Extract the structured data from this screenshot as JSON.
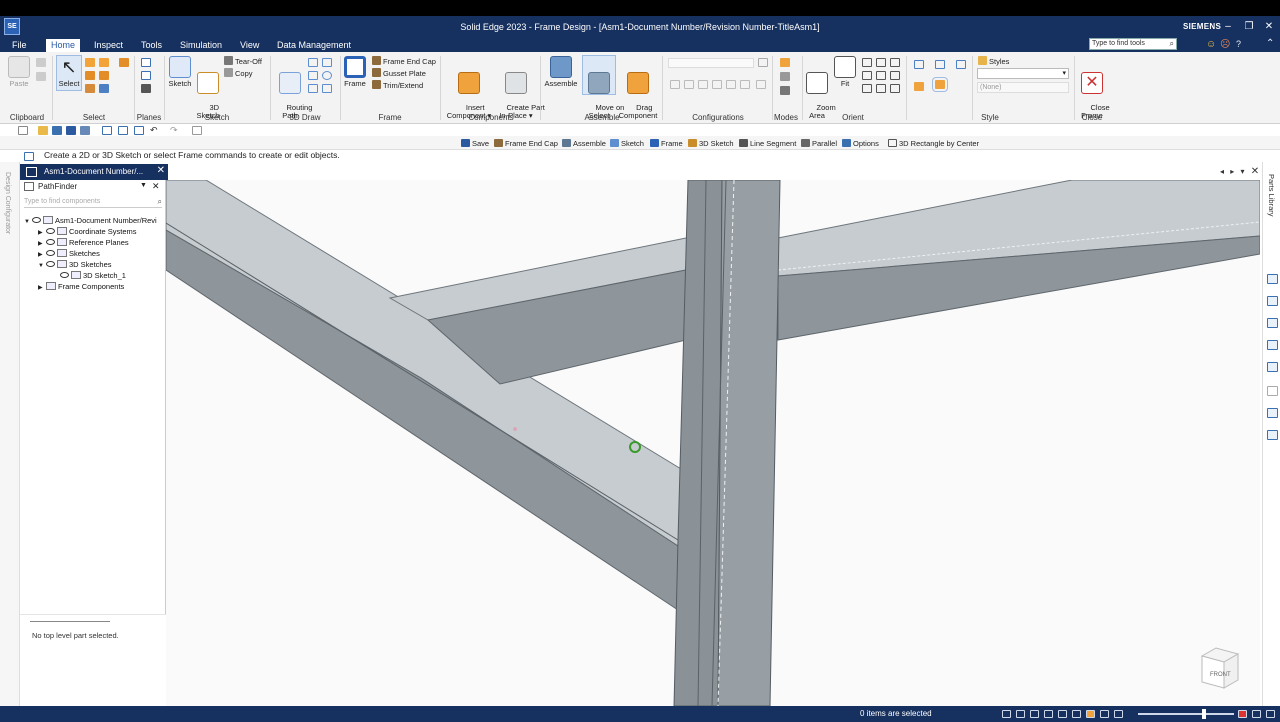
{
  "titlebar": {
    "app_logo": "SE",
    "title": "Solid Edge 2023 - Frame Design - [Asm1-Document Number/Revision Number-TitleAsm1]",
    "brand": "SIEMENS",
    "buttons": [
      "–",
      "❐",
      "✕"
    ]
  },
  "menubar": {
    "items": [
      "File",
      "Home",
      "Inspect",
      "Tools",
      "Simulation",
      "View",
      "Data Management"
    ],
    "active": "Home",
    "search_placeholder": "Type to find tools"
  },
  "ribbon": {
    "clipboard": {
      "paste": "Paste",
      "group": "Clipboard"
    },
    "select": {
      "select": "Select",
      "group": "Select"
    },
    "planes": {
      "group": "Planes"
    },
    "sketch": {
      "sketch": "Sketch",
      "sketch3d": "3D\nSketch",
      "tearoff": "Tear-Off",
      "copy": "Copy",
      "group": "Sketch"
    },
    "draw3d": {
      "routing": "Routing\nPath",
      "group": "3D Draw"
    },
    "frame": {
      "frame": "Frame",
      "end_cap": "Frame End Cap",
      "gusset": "Gusset Plate",
      "trim": "Trim/Extend",
      "group": "Frame"
    },
    "components": {
      "insert": "Insert\nComponent ▾",
      "create": "Create Part\nIn-Place ▾",
      "group": "Components"
    },
    "assemble": {
      "assemble": "Assemble",
      "move": "Move on\nSelect",
      "drag": "Drag\nComponent",
      "group": "Assemble"
    },
    "configurations": {
      "group": "Configurations"
    },
    "modes": {
      "group": "Modes"
    },
    "orient": {
      "zoom": "Zoom\nArea",
      "fit": "Fit",
      "group": "Orient"
    },
    "style": {
      "styles": "Styles",
      "none": "(None)",
      "group": "Style"
    },
    "close": {
      "label": "Close\nFrame",
      "group": "Close"
    }
  },
  "commandbar": {
    "items": [
      "Save",
      "Frame End Cap",
      "Assemble",
      "Sketch",
      "Frame",
      "3D Sketch",
      "Line Segment",
      "Parallel",
      "Options",
      "3D Rectangle by Center"
    ]
  },
  "prompt": "Create a 2D or 3D Sketch or select Frame commands to create or edit objects.",
  "left_strip_label": "Design Configurator",
  "doc_tab": "Asm1-Document Number/...",
  "pathfinder": {
    "title": "PathFinder",
    "search_placeholder": "Type to find components",
    "tree": [
      {
        "label": "Asm1-Document Number/Revi",
        "level": 0,
        "expanded": true
      },
      {
        "label": "Coordinate Systems",
        "level": 1,
        "expanded": false
      },
      {
        "label": "Reference Planes",
        "level": 1,
        "expanded": false
      },
      {
        "label": "Sketches",
        "level": 1,
        "expanded": false
      },
      {
        "label": "3D Sketches",
        "level": 1,
        "expanded": true
      },
      {
        "label": "3D Sketch_1",
        "level": 2
      },
      {
        "label": "Frame Components",
        "level": 0,
        "expanded": false
      }
    ],
    "lower_message": "No top level part selected."
  },
  "right_strip_label": "Parts Library",
  "navcube_label": "FRONT",
  "status": "0 items are selected",
  "colors": {
    "dark_blue": "#16305f",
    "beam": "#8e969c",
    "beam_top": "#c6ccd0",
    "viewport": "#fafafa"
  }
}
